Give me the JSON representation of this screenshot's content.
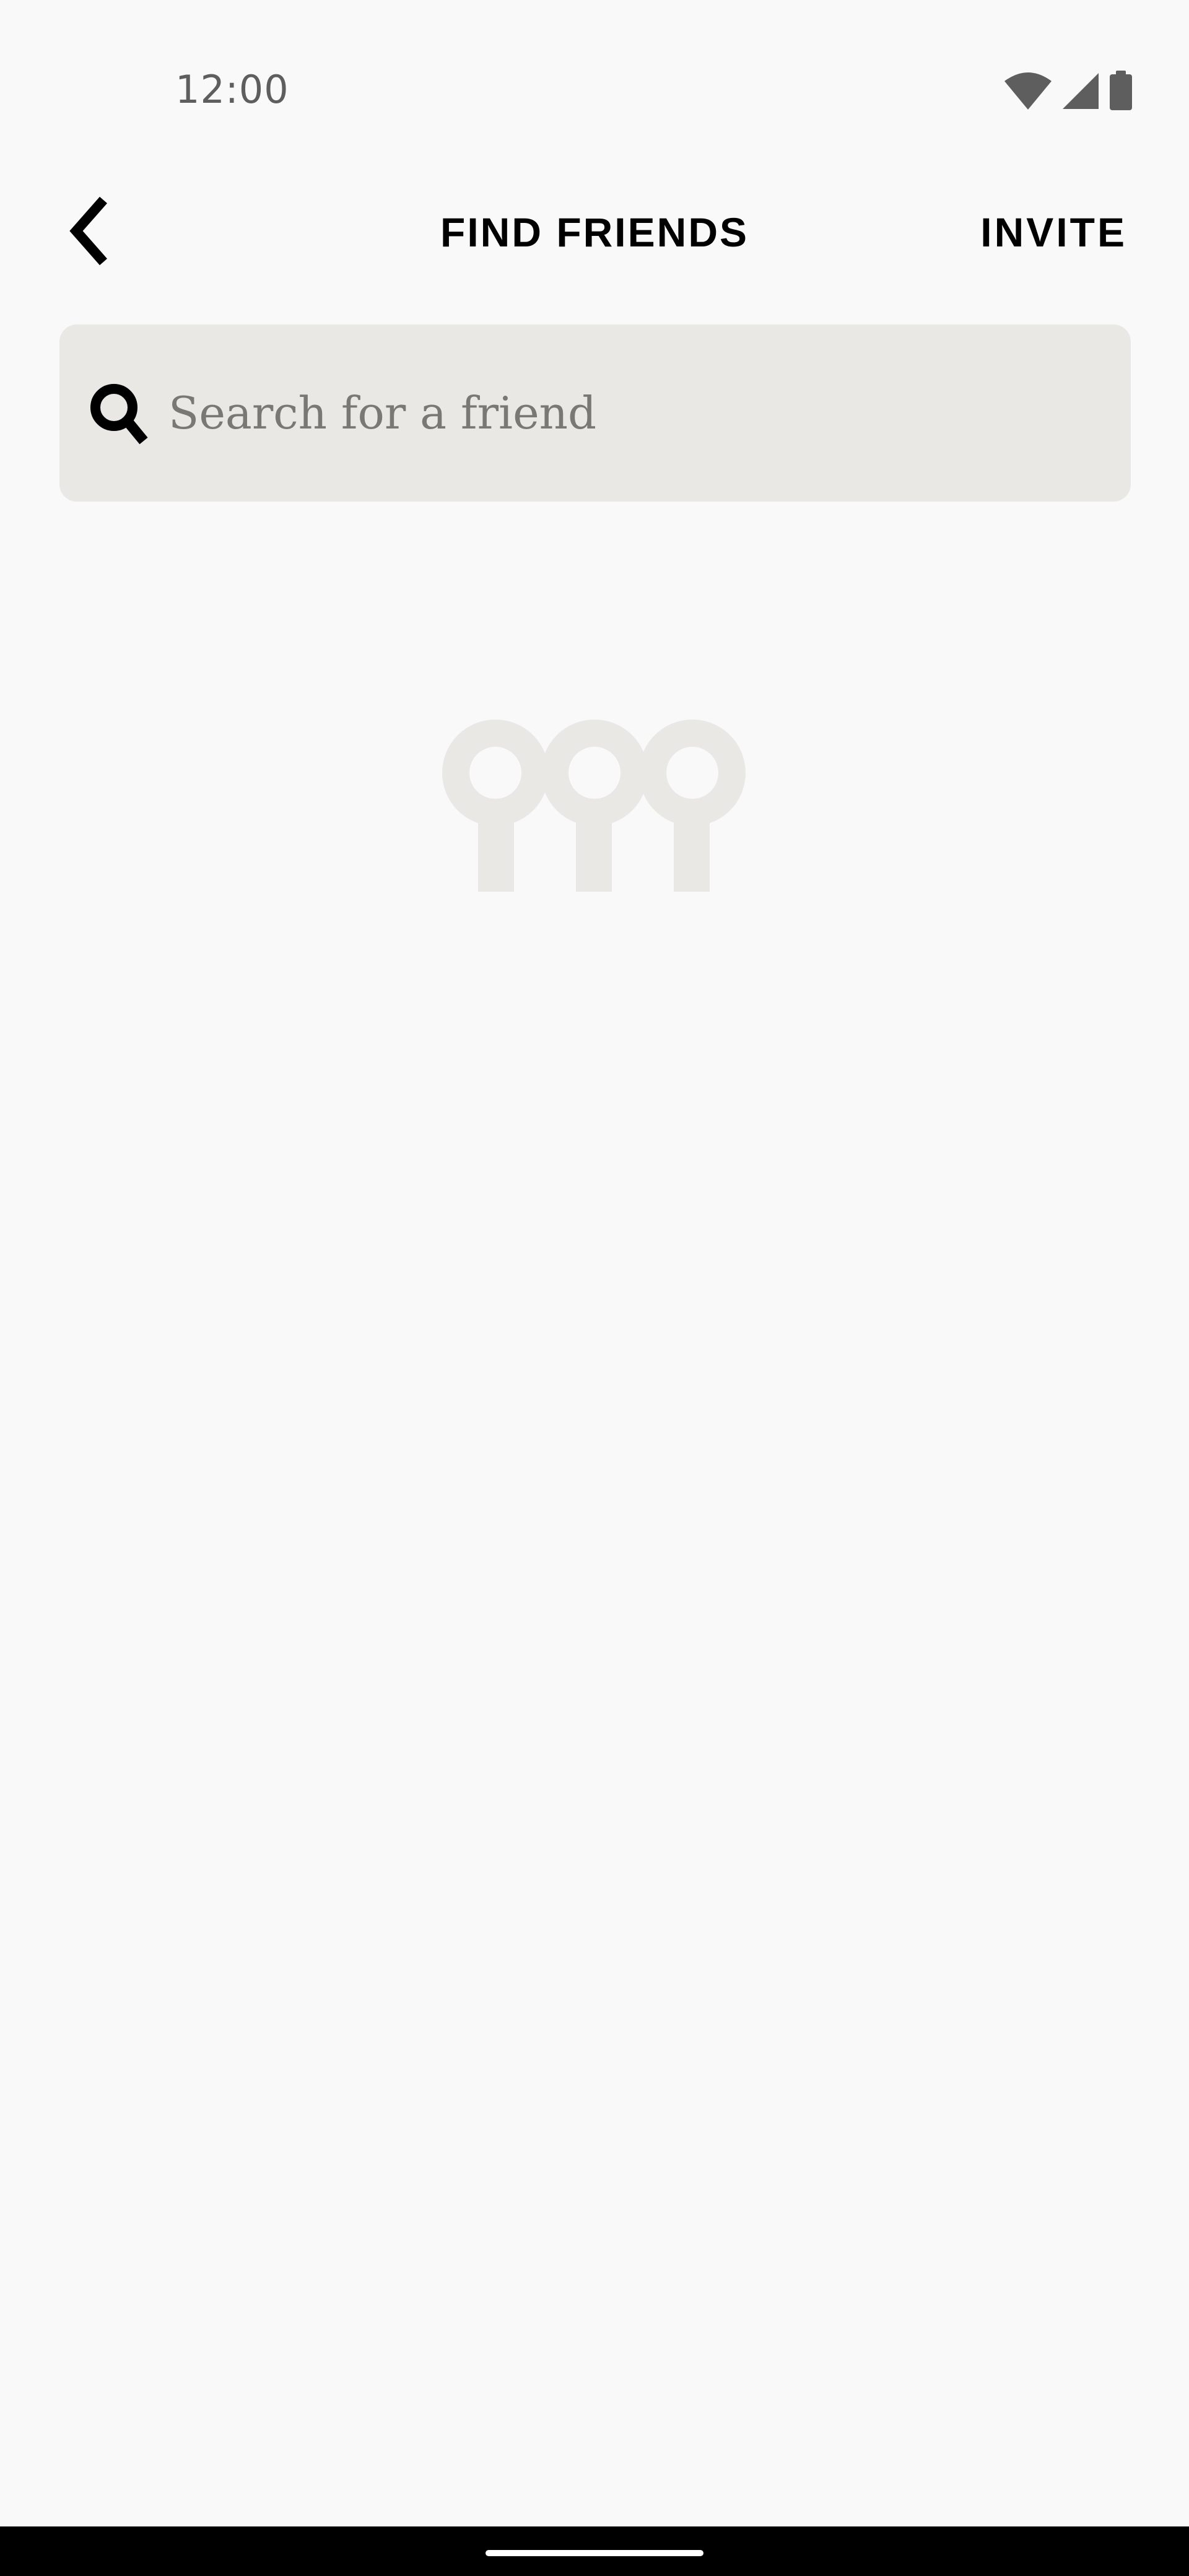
{
  "status_bar": {
    "time": "12:00",
    "icons": [
      "wifi-icon",
      "cellular-signal-icon",
      "battery-icon"
    ],
    "icon_color": "#5e5e5e"
  },
  "app_bar": {
    "back_icon": "chevron-left-icon",
    "title": "FIND FRIENDS",
    "invite_label": "INVITE"
  },
  "search": {
    "icon": "search-icon",
    "placeholder": "Search for a friend",
    "value": ""
  },
  "empty_state": {
    "icon": "friends-group-icon",
    "color": "#e9e8e5"
  },
  "colors": {
    "background": "#f9f9f9",
    "search_background": "#e9e8e5",
    "text_primary": "#000000",
    "placeholder": "#7a7873"
  }
}
